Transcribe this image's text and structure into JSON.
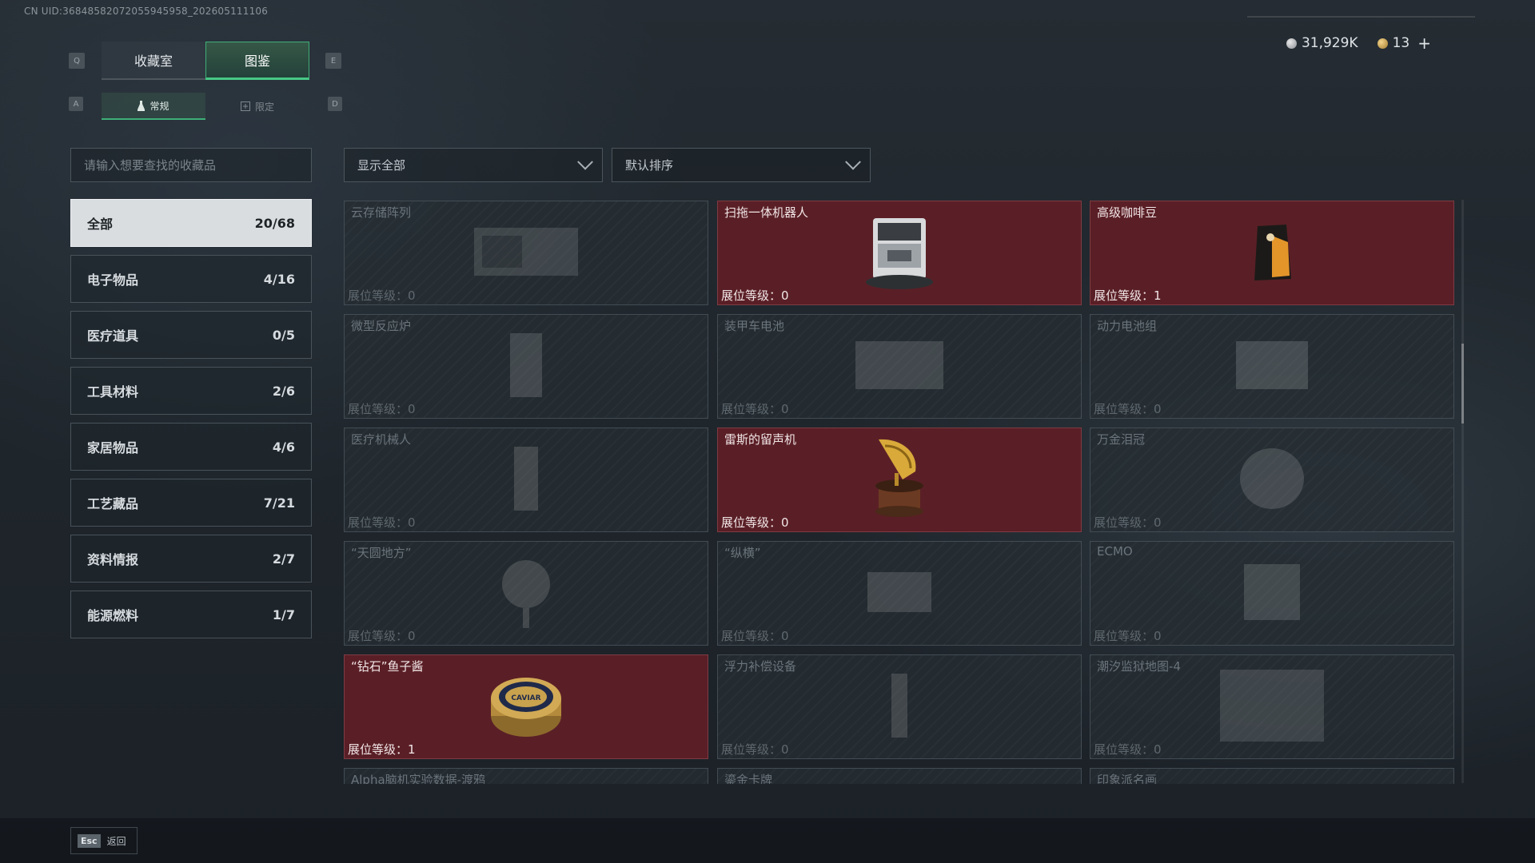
{
  "header": {
    "uid": "CN UID:36848582072055945958_202605111106",
    "currency": {
      "silver": "31,929K",
      "gold": "13",
      "add_label": "+"
    }
  },
  "tabs": {
    "key_prev": "Q",
    "key_next": "E",
    "items": [
      {
        "label": "收藏室"
      },
      {
        "label": "图鉴"
      }
    ],
    "active": "图鉴"
  },
  "subtabs": {
    "key_prev": "A",
    "key_next": "D",
    "items": [
      {
        "label": "常规"
      },
      {
        "label": "限定"
      }
    ],
    "active": "常规"
  },
  "search": {
    "placeholder": "请输入想要查找的收藏品",
    "value": ""
  },
  "filters": {
    "display": "显示全部",
    "sort": "默认排序"
  },
  "categories": [
    {
      "label": "全部",
      "count": "20/68",
      "active": true
    },
    {
      "label": "电子物品",
      "count": "4/16"
    },
    {
      "label": "医疗道具",
      "count": "0/5"
    },
    {
      "label": "工具材料",
      "count": "2/6"
    },
    {
      "label": "家居物品",
      "count": "4/6"
    },
    {
      "label": "工艺藏品",
      "count": "7/21"
    },
    {
      "label": "资料情报",
      "count": "2/7"
    },
    {
      "label": "能源燃料",
      "count": "1/7"
    }
  ],
  "level_prefix": "展位等级：",
  "items": [
    {
      "name": "云存储阵列",
      "level": "0",
      "owned": false,
      "icon": "server-rack-icon"
    },
    {
      "name": "扫拖一体机器人",
      "level": "0",
      "owned": true,
      "icon": "robot-vacuum-icon"
    },
    {
      "name": "高级咖啡豆",
      "level": "1",
      "owned": true,
      "icon": "coffee-bag-icon"
    },
    {
      "name": "微型反应炉",
      "level": "0",
      "owned": false,
      "icon": "reactor-icon"
    },
    {
      "name": "装甲车电池",
      "level": "0",
      "owned": false,
      "icon": "battery-icon"
    },
    {
      "name": "动力电池组",
      "level": "0",
      "owned": false,
      "icon": "battery-pack-icon"
    },
    {
      "name": "医疗机械人",
      "level": "0",
      "owned": false,
      "icon": "medical-robot-icon"
    },
    {
      "name": "雷斯的留声机",
      "level": "0",
      "owned": true,
      "icon": "gramophone-icon"
    },
    {
      "name": "万金泪冠",
      "level": "0",
      "owned": false,
      "icon": "crown-icon"
    },
    {
      "name": "“天圆地方”",
      "level": "0",
      "owned": false,
      "icon": "globe-icon"
    },
    {
      "name": "“纵横”",
      "level": "0",
      "owned": false,
      "icon": "chessboard-icon"
    },
    {
      "name": "ECMO",
      "level": "0",
      "owned": false,
      "icon": "ecmo-icon"
    },
    {
      "name": "“钻石”鱼子酱",
      "level": "1",
      "owned": true,
      "icon": "caviar-tin-icon",
      "tin_text": "CAVIAR"
    },
    {
      "name": "浮力补偿设备",
      "level": "0",
      "owned": false,
      "icon": "buoyancy-device-icon"
    },
    {
      "name": "潮汐监狱地图-4",
      "level": "0",
      "owned": false,
      "icon": "map-icon"
    },
    {
      "name": "Alpha脑机实验数据-渡鸦",
      "level": "",
      "owned": false,
      "icon": ""
    },
    {
      "name": "鎏金卡牌",
      "level": "",
      "owned": false,
      "icon": ""
    },
    {
      "name": "印象派名画",
      "level": "",
      "owned": false,
      "icon": ""
    }
  ],
  "footer": {
    "esc_key": "Esc",
    "esc_label": "返回"
  }
}
